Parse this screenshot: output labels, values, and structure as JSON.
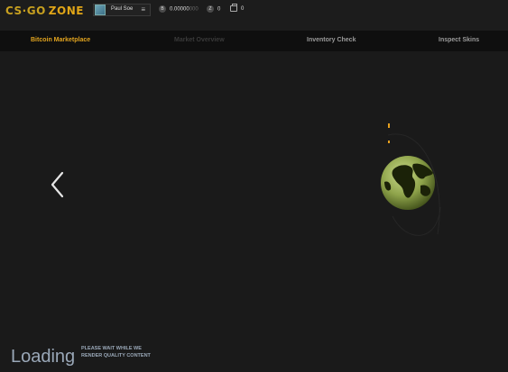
{
  "app": {
    "logo_part1": "CS",
    "logo_sep": "·",
    "logo_part2": "GO",
    "logo_part3": "ZONE"
  },
  "header": {
    "user_name": "Paul Soe",
    "balance_icon": "bitcoin-icon",
    "balance_main": "0.00000",
    "balance_dim": "000",
    "z_icon": "z-icon",
    "z_count": "0",
    "bag_icon": "bag-icon",
    "bag_count": "0"
  },
  "nav": {
    "items": [
      {
        "label": "Bitcoin Marketplace",
        "state": "active"
      },
      {
        "label": "Market Overview",
        "state": "disabled"
      },
      {
        "label": "Inventory Check",
        "state": "normal"
      },
      {
        "label": "Inspect Skins",
        "state": "normal"
      }
    ]
  },
  "main": {
    "prev_icon": "chevron-left-icon",
    "globe_icon": "globe-icon"
  },
  "loading": {
    "title": "Loading",
    "note": "PLEASE WAIT WHILE WE RENDER QUALITY CONTENT"
  },
  "colors": {
    "accent": "#e2a41f",
    "background": "#1a1a1a",
    "nav_background": "#0f0f0f",
    "loading_text": "#9aa8b8"
  }
}
